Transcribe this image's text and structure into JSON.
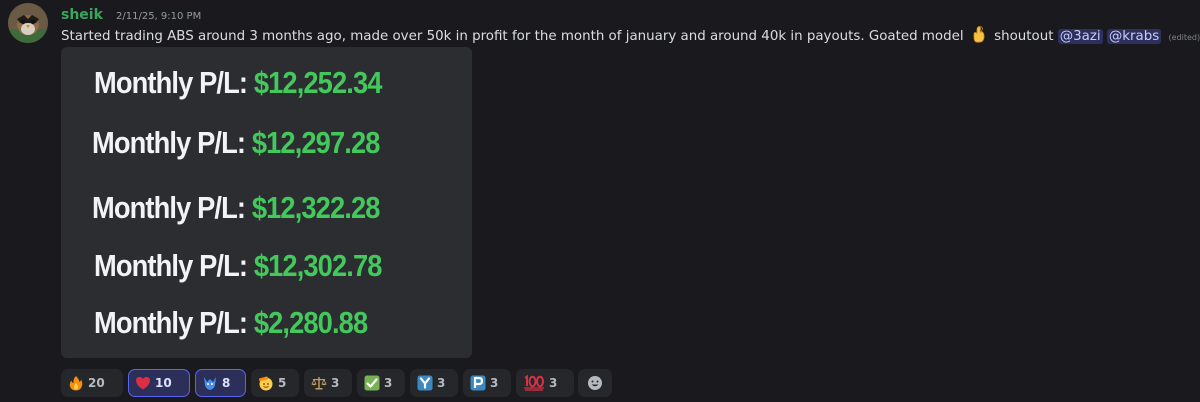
{
  "message": {
    "username": "sheik",
    "timestamp": "2/11/25, 9:10 PM",
    "text_main": "Started trading ABS around 3 months ago, made over 50k in profit for the month of january and around 40k in payouts. Goated model",
    "text_after_emoji": "shoutout",
    "mentions": [
      "@3azi",
      "@krabs"
    ],
    "edited_label": "(edited)",
    "inline_emoji": "crossed-fingers-icon"
  },
  "attachment": {
    "lines": [
      {
        "label": "Monthly P/L:",
        "value": "$12,252.34"
      },
      {
        "label": "Monthly P/L:",
        "value": "$12,297.28"
      },
      {
        "label": "Monthly P/L:",
        "value": "$12,322.28"
      },
      {
        "label": "Monthly P/L:",
        "value": "$12,302.78"
      },
      {
        "label": "Monthly P/L:",
        "value": "$2,280.88"
      }
    ],
    "colors": {
      "label": "#f2f3f5",
      "value": "#43c95b",
      "background": "#2b2d31"
    }
  },
  "reactions": [
    {
      "icon": "fire-icon",
      "count": "20",
      "active": false
    },
    {
      "icon": "heart-icon",
      "count": "10",
      "active": true
    },
    {
      "icon": "custom-wolf-icon",
      "count": "8",
      "active": true
    },
    {
      "icon": "saluting-face-icon",
      "count": "5",
      "active": false
    },
    {
      "icon": "scales-icon",
      "count": "3",
      "active": false
    },
    {
      "icon": "check-mark-icon",
      "count": "3",
      "active": false
    },
    {
      "icon": "letter-y-icon",
      "count": "3",
      "active": false
    },
    {
      "icon": "letter-p-icon",
      "count": "3",
      "active": false
    },
    {
      "icon": "hundred-points-icon",
      "count": "3",
      "active": false
    }
  ],
  "add_reaction_icon": "smiley-icon"
}
